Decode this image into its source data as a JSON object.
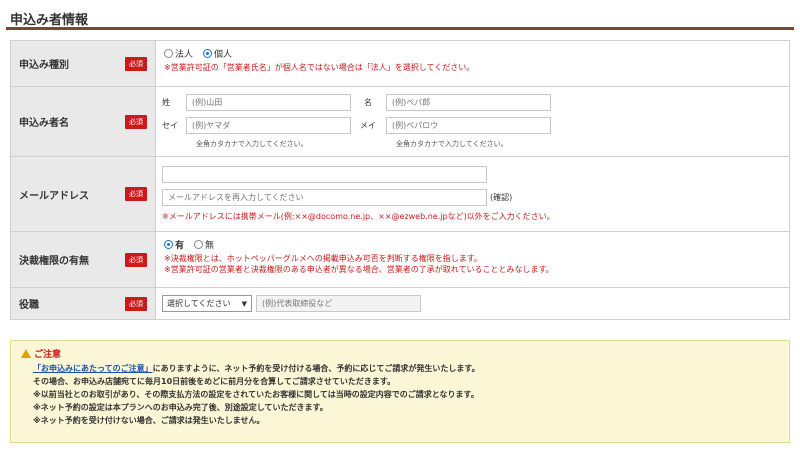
{
  "section": {
    "title": "申込み者情報"
  },
  "required_label": "必須",
  "rows": {
    "entity_type": {
      "label": "申込み種別",
      "options": [
        "法人",
        "個人"
      ],
      "selected_index": 1,
      "note": "※営業許可証の「営業者氏名」が個人名ではない場合は「法人」を選択してください。"
    },
    "applicant_name": {
      "label": "申込み者名",
      "sei_label": "姓",
      "mei_label": "名",
      "sei_kana_label": "セイ",
      "mei_kana_label": "メイ",
      "sei_placeholder": "(例)山田",
      "mei_placeholder": "(例)ぺパ郎",
      "sei_kana_placeholder": "(例)ヤマダ",
      "mei_kana_placeholder": "(例)ペパロウ",
      "kana_hint_left": "全角カタカナで入力してください。",
      "kana_hint_right": "全角カタカナで入力してください。"
    },
    "email": {
      "label": "メールアドレス",
      "value": "",
      "confirm_placeholder": "メールアドレスを再入力してください",
      "confirm_suffix": "(確認)",
      "note": "※メールアドレスには携帯メール(例:××@docomo.ne.jp、××@ezweb.ne.jpなど)以外をご入力ください。"
    },
    "authority": {
      "label": "決裁権限の有無",
      "options": [
        "有",
        "無"
      ],
      "selected_index": 0,
      "note1": "※決裁権限とは、ホットペッパーグルメへの掲載申込み可否を判断する権限を指します。",
      "note2": "※営業許可証の営業者と決裁権限のある申込者が異なる場合、営業者の了承が取れていることとみなします。"
    },
    "position": {
      "label": "役職",
      "select_value": "選択してください",
      "text_placeholder": "(例)代表取締役など"
    }
  },
  "notice": {
    "title": "ご注意",
    "link_text": "「お申込みにあたってのご注意」",
    "line1_rest": "にありますように、ネット予約を受け付ける場合、予約に応じてご請求が発生いたします。",
    "line2": "その場合、お申込み店舗宛てに毎月10日前後をめどに前月分を合算してご請求させていただきます。",
    "line3": "※以前当社とのお取引があり、その際支払方法の設定をされていたお客様に関しては当時の設定内容でのご請求となります。",
    "line4": "※ネット予約の設定は本プランへのお申込み完了後、別途設定していただきます。",
    "line5": "※ネット予約を受け付けない場合、ご請求は発生いたしません。"
  }
}
